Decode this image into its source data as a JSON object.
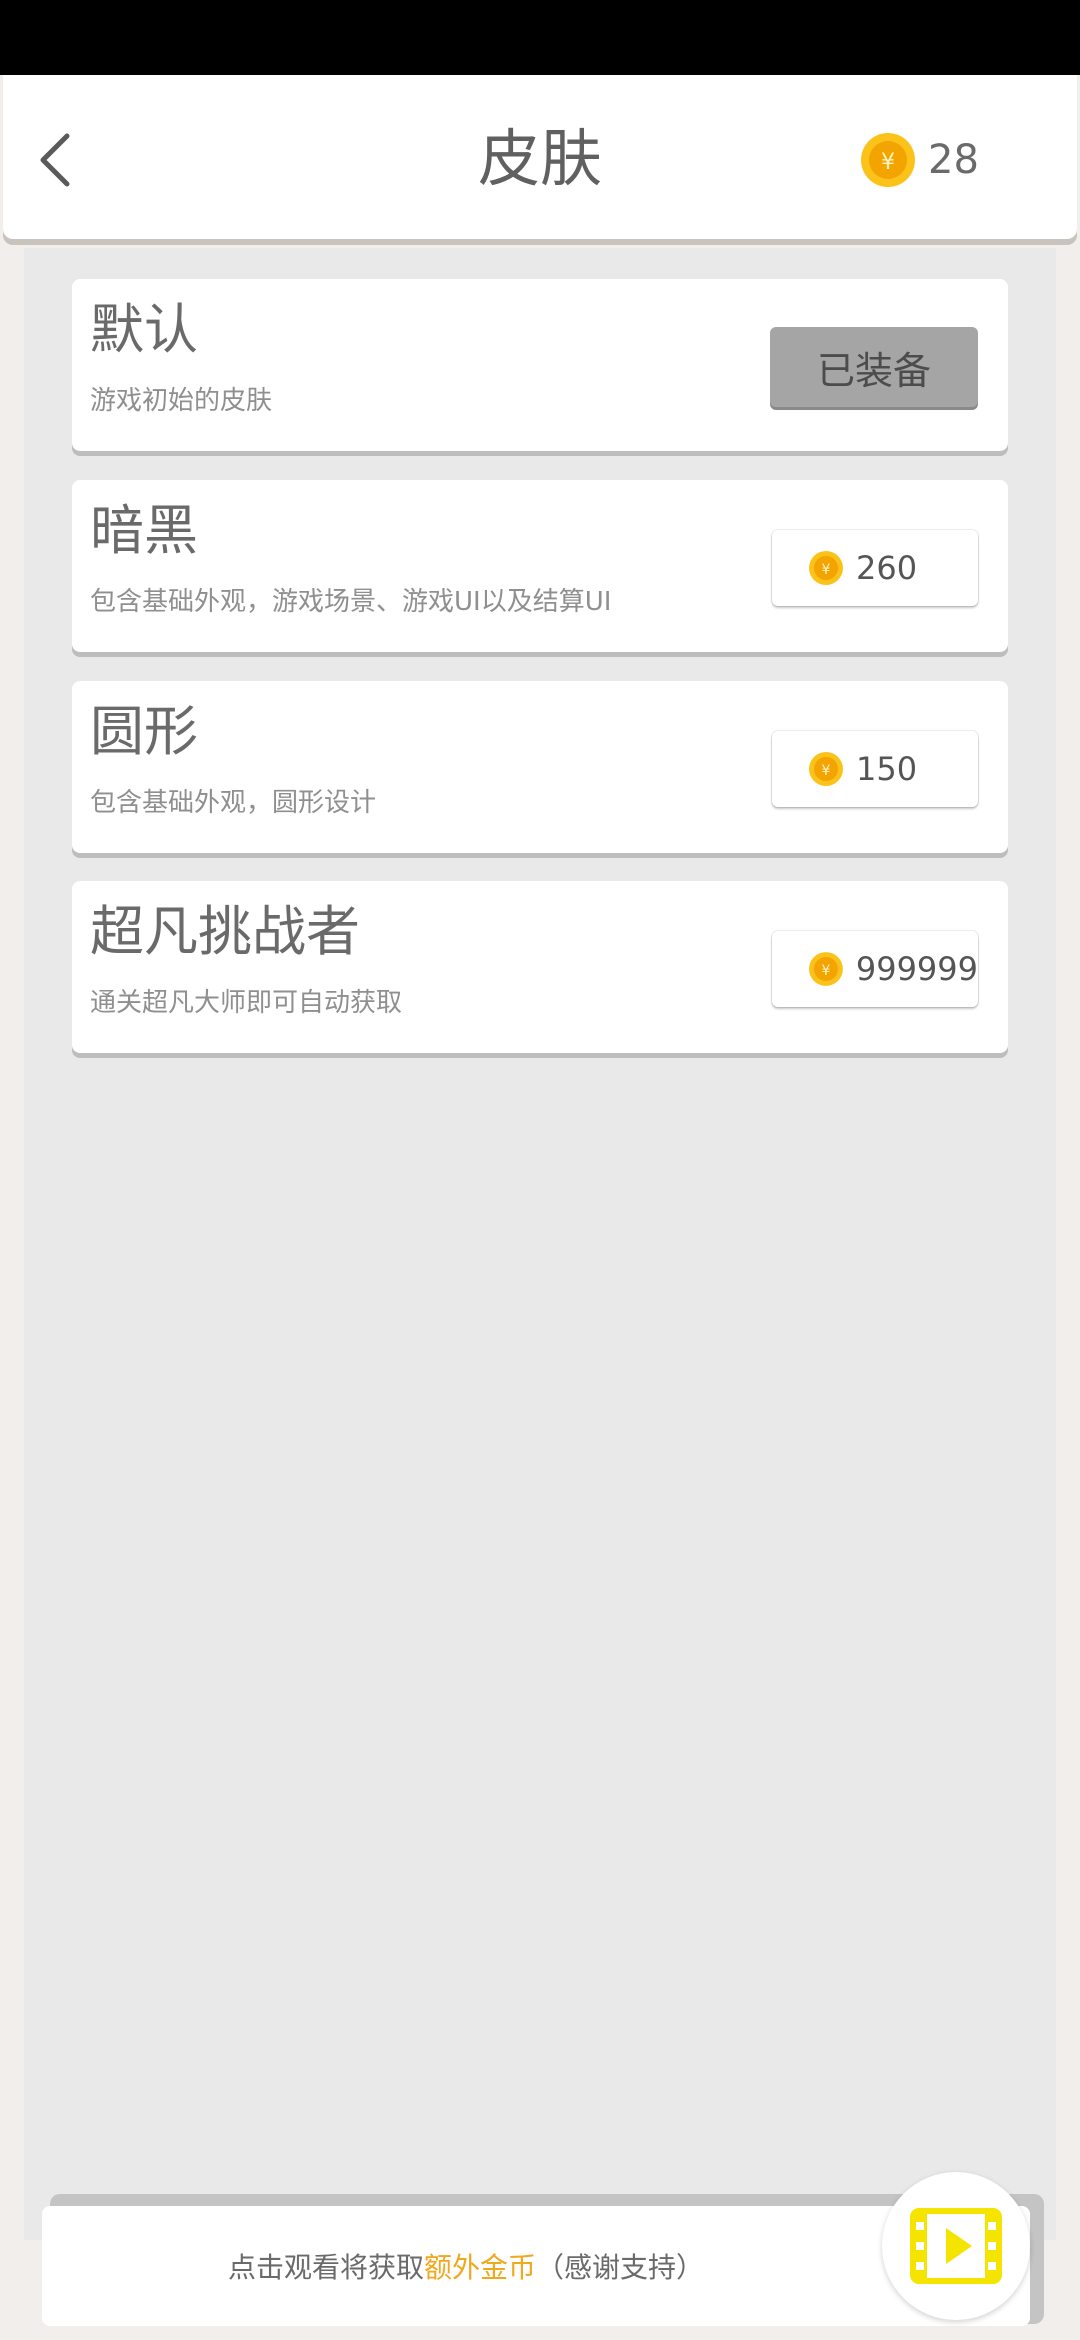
{
  "header": {
    "title": "皮肤",
    "coin_balance": "28",
    "back_icon": "chevron-left-icon",
    "coin_icon": "yuan-coin-icon"
  },
  "skins": [
    {
      "name": "默认",
      "description": "游戏初始的皮肤",
      "status_label": "已装备",
      "equipped": true
    },
    {
      "name": "暗黑",
      "description": "包含基础外观，游戏场景、游戏UI以及结算UI",
      "price": "260",
      "equipped": false
    },
    {
      "name": "圆形",
      "description": "包含基础外观，圆形设计",
      "price": "150",
      "equipped": false
    },
    {
      "name": "超凡挑战者",
      "description": "通关超凡大师即可自动获取",
      "price": "999999",
      "equipped": false
    }
  ],
  "footer": {
    "text_before": "点击观看将获取",
    "text_highlight": "额外金币",
    "text_after": "（感谢支持）",
    "video_icon": "film-play-icon"
  },
  "colors": {
    "coin": "#f7b500",
    "highlight": "#f0a81c",
    "video_icon": "#f5e400"
  }
}
